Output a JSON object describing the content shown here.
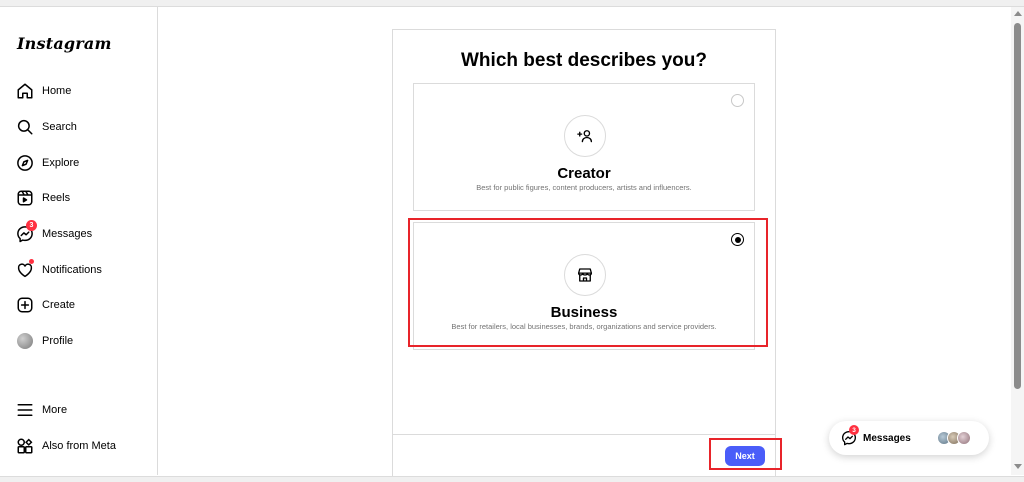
{
  "app": {
    "logo_text": "Instagram"
  },
  "sidebar": {
    "items": [
      {
        "label": "Home",
        "icon": "home-icon"
      },
      {
        "label": "Search",
        "icon": "search-icon"
      },
      {
        "label": "Explore",
        "icon": "compass-icon"
      },
      {
        "label": "Reels",
        "icon": "reels-icon"
      },
      {
        "label": "Messages",
        "icon": "messenger-icon",
        "badge": "3"
      },
      {
        "label": "Notifications",
        "icon": "heart-icon",
        "dot": true
      },
      {
        "label": "Create",
        "icon": "plus-square-icon"
      },
      {
        "label": "Profile",
        "icon": "avatar"
      }
    ],
    "bottom_items": [
      {
        "label": "More",
        "icon": "menu-icon"
      },
      {
        "label": "Also from Meta",
        "icon": "meta-apps-icon"
      }
    ]
  },
  "dialog": {
    "title": "Which best describes you?",
    "options": [
      {
        "title": "Creator",
        "description": "Best for public figures, content producers, artists and influencers.",
        "icon": "creator-icon",
        "selected": false
      },
      {
        "title": "Business",
        "description": "Best for retailers, local businesses, brands, organizations and service providers.",
        "icon": "storefront-icon",
        "selected": true
      }
    ],
    "next_label": "Next"
  },
  "messages_pill": {
    "label": "Messages",
    "badge": "3"
  },
  "colors": {
    "primary_button": "#4a5df9",
    "badge": "#ff3040",
    "highlight": "#e8242a"
  }
}
